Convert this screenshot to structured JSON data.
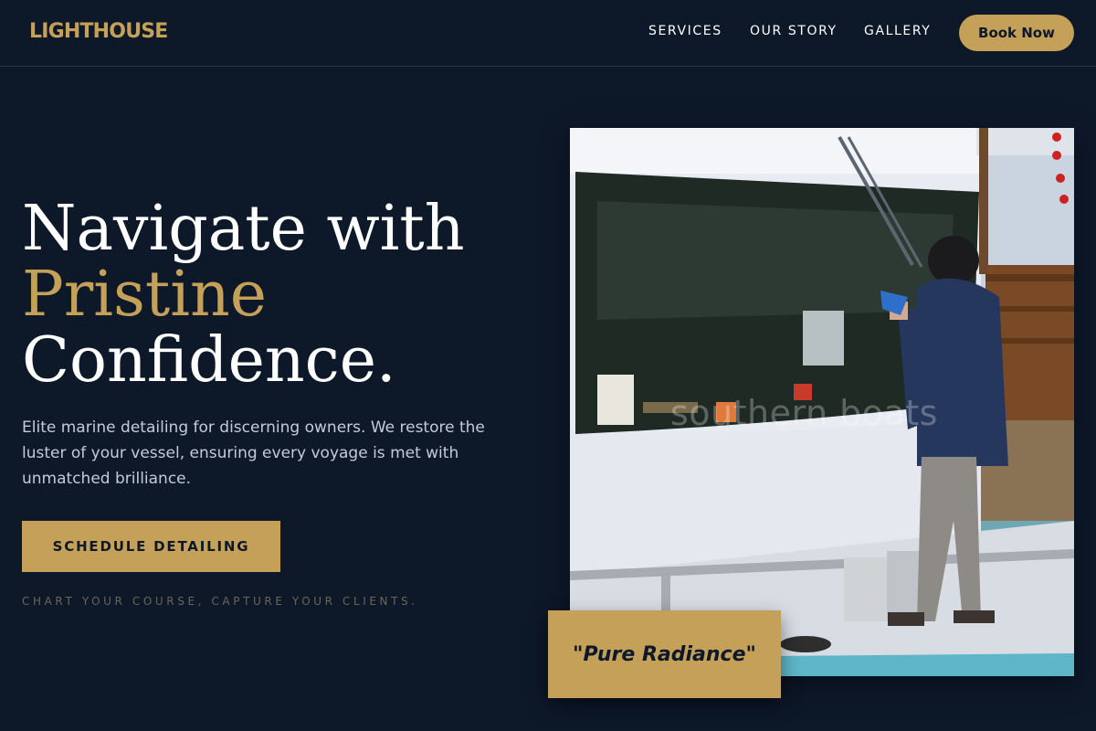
{
  "brand": {
    "logo": "LIGHTHOUSE"
  },
  "nav": {
    "links": [
      "SERVICES",
      "OUR STORY",
      "GALLERY"
    ],
    "book_label": "Book Now"
  },
  "hero": {
    "title_line1": "Navigate with",
    "title_accent": "Pristine",
    "title_line3": "Confidence.",
    "description": "Elite marine detailing for discerning owners. We restore the luster of your vessel, ensuring every voyage is met with unmatched brilliance.",
    "cta_label": "SCHEDULE DETAILING",
    "tagline": "CHART YOUR COURSE, CAPTURE YOUR CLIENTS."
  },
  "media": {
    "watermark": "southern boats",
    "quote": "\"Pure Radiance\""
  },
  "colors": {
    "background": "#0d1829",
    "accent": "#c5a059",
    "text": "#ffffff",
    "muted": "#c3cbd8"
  }
}
